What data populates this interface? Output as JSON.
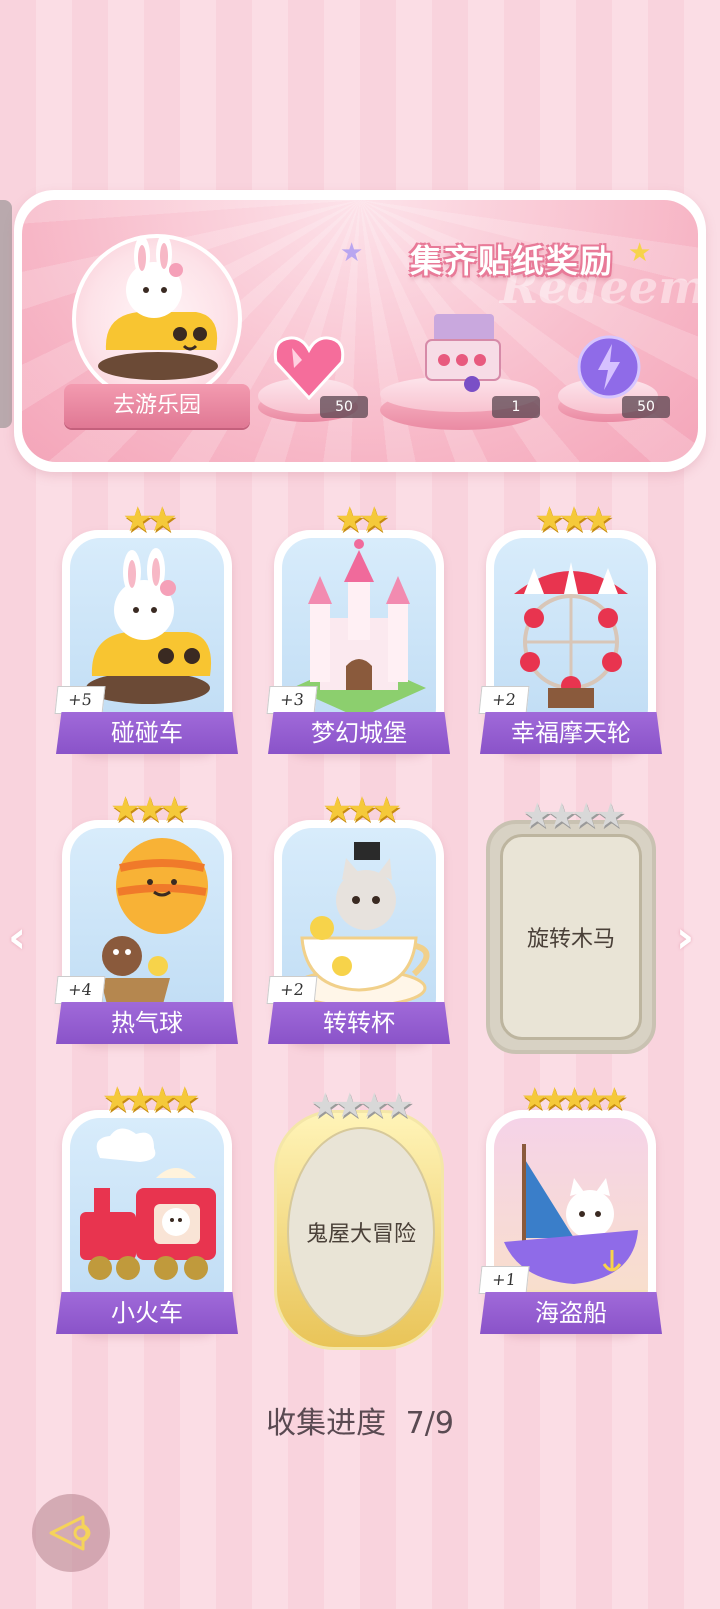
{
  "banner": {
    "title": "集齐贴纸奖励",
    "watermark": "Redeem",
    "go_label": "去游乐园",
    "rewards": [
      {
        "name": "heart-gem",
        "count": "50"
      },
      {
        "name": "gift-box",
        "count": "1"
      },
      {
        "name": "energy-orb",
        "count": "50"
      }
    ]
  },
  "cards": [
    {
      "name": "碰碰车",
      "plus": "+5",
      "stars": 2,
      "total_stars": 2,
      "unlocked": true
    },
    {
      "name": "梦幻城堡",
      "plus": "+3",
      "stars": 2,
      "total_stars": 2,
      "unlocked": true
    },
    {
      "name": "幸福摩天轮",
      "plus": "+2",
      "stars": 3,
      "total_stars": 3,
      "unlocked": true
    },
    {
      "name": "热气球",
      "plus": "+4",
      "stars": 3,
      "total_stars": 3,
      "unlocked": true
    },
    {
      "name": "转转杯",
      "plus": "+2",
      "stars": 3,
      "total_stars": 3,
      "unlocked": true
    },
    {
      "name": "旋转木马",
      "plus": "",
      "stars": 0,
      "total_stars": 4,
      "unlocked": false
    },
    {
      "name": "小火车",
      "plus": "",
      "stars": 4,
      "total_stars": 4,
      "unlocked": true
    },
    {
      "name": "鬼屋大冒险",
      "plus": "",
      "stars": 0,
      "total_stars": 4,
      "unlocked": false
    },
    {
      "name": "海盗船",
      "plus": "+1",
      "stars": 5,
      "total_stars": 5,
      "unlocked": true
    }
  ],
  "progress": {
    "label": "收集进度",
    "value": "7/9"
  },
  "colors": {
    "accent_purple": "#8a53c9",
    "pink": "#f7b6c6",
    "star_gold": "#f5c93a"
  }
}
